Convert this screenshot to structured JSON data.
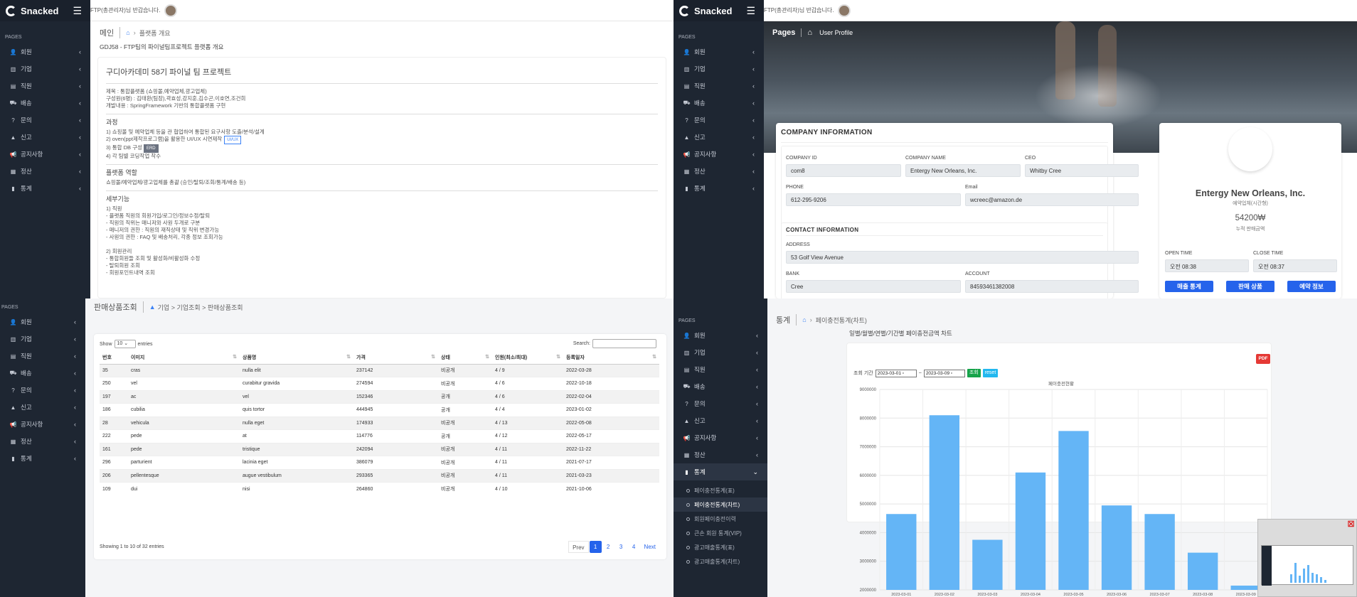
{
  "brand": "Snacked",
  "header": {
    "greeting": "FTP(총관리자)님 반갑습니다."
  },
  "sidebar": {
    "section": "PAGES",
    "items": [
      {
        "label": "회원",
        "icon": "user-icon"
      },
      {
        "label": "기업",
        "icon": "building-icon"
      },
      {
        "label": "직원",
        "icon": "id-card-icon"
      },
      {
        "label": "배송",
        "icon": "truck-icon"
      },
      {
        "label": "문의",
        "icon": "question-icon"
      },
      {
        "label": "신고",
        "icon": "warning-icon"
      },
      {
        "label": "공지사항",
        "icon": "megaphone-icon"
      },
      {
        "label": "정산",
        "icon": "receipt-icon"
      },
      {
        "label": "통계",
        "icon": "bar-chart-icon"
      }
    ],
    "stats_sub": [
      "페이충전통계(표)",
      "페이충전통계(차트)",
      "회원페이충전이력",
      "큰손 회원 통계(VIP)",
      "광고매출통계(표)",
      "광고매출통계(차트)"
    ]
  },
  "q1": {
    "crumb_title": "메인",
    "crumb_page": "플랫폼 개요",
    "heading": "GDJ58 - FTP팀의 파이널팀프로젝트 플랫폼 개요",
    "card_title": "구디아카데미 58기 파이널 팀 프로젝트",
    "info": [
      "제목 : 통합플랫폼 (쇼핑몰,예약업체,광고업체)",
      "구성원(6명) : 김태환(팀장),곽효성,강지훈,김수곤,이호연,조건희",
      "개발내용 : SpringFramework 기반의 통합플랫폼 구현"
    ],
    "process_title": "과정",
    "process": [
      "1) 쇼핑몰 및 예약업체 등을 관 협업하여 통합된 요구사항 도출/분석/설계",
      "2) oven(ppt제작프로그램)을 활용한 UI/UX 시연제작",
      "3) 통합 DB 구성",
      "4) 각 팀별 코딩작업 착수"
    ],
    "tag_uiux": "UI/UX",
    "tag_erd": "ERD",
    "role_title": "플랫폼 역할",
    "role": "쇼핑몰/예약업체/광고업체를 총괄 (승인/탈퇴/조회/통계/배송 등)",
    "detail_title": "세부기능",
    "detail": [
      "1) 직원",
      "- 플랫폼 직원의 회원가입/로그인/정보수정/탈퇴",
      "- 직원의 직위는 매니저와 사원 두개로 구분",
      "- 매니저의 권한 : 직원의 재직상태 및 직위 변경가능",
      "- 사원의 권한 : FAQ 및 배송처리, 각종 정보 조회가능",
      "",
      "2) 회원관리",
      "- 통합회원들 조회 및 활성화/비활성화 수정",
      "- 탈퇴회원 조회",
      "- 회원포인트내역 조회"
    ]
  },
  "q2": {
    "page_title": "Pages",
    "crumb_page": "User Profile",
    "company_title": "COMPANY INFORMATION",
    "company": [
      {
        "label": "COMPANY ID",
        "value": "com8"
      },
      {
        "label": "COMPANY NAME",
        "value": "Entergy New Orleans, Inc."
      },
      {
        "label": "CEO",
        "value": "Whitby Cree"
      },
      {
        "label": "PHONE",
        "value": "612-295-9206"
      },
      {
        "label": "Email",
        "value": "wcreec@amazon.de"
      }
    ],
    "contact_title": "CONTACT INFORMATION",
    "contact": [
      {
        "label": "ADDRESS",
        "value": "53 Golf View Avenue"
      },
      {
        "label": "BANK",
        "value": "Cree"
      },
      {
        "label": "ACCOUNT",
        "value": "84593461382008"
      }
    ],
    "profile": {
      "name": "Entergy New Orleans, Inc.",
      "type": "예약업체(시간형)",
      "amount": "54200₩",
      "amount_label": "누적 판매금액",
      "open_label": "OPEN TIME",
      "open": "오전 08:38",
      "close_label": "CLOSE TIME",
      "close": "오전 08:37",
      "buttons": [
        "매출 통계",
        "판매 상품",
        "예약 정보"
      ]
    }
  },
  "q3": {
    "crumb_title": "판매상품조회",
    "crumb_path": "기업 > 기업조회 > 판매상품조회",
    "show": "Show",
    "show_value": "10",
    "entries": "entries",
    "search_label": "Search:",
    "columns": [
      "번호",
      "이미지",
      "상품명",
      "가격",
      "상태",
      "인원(최소/최대)",
      "등록일자"
    ],
    "rows": [
      [
        "35",
        "cras",
        "nulla elit",
        "237142",
        "비공개",
        "4 / 9",
        "2022-03-28"
      ],
      [
        "250",
        "vel",
        "curabitur gravida",
        "274594",
        "비공개",
        "4 / 6",
        "2022-10-18"
      ],
      [
        "197",
        "ac",
        "vel",
        "152346",
        "공개",
        "4 / 6",
        "2022-02-04"
      ],
      [
        "186",
        "cubilia",
        "quis tortor",
        "444945",
        "공개",
        "4 / 4",
        "2023-01-02"
      ],
      [
        "28",
        "vehicula",
        "nulla eget",
        "174933",
        "비공개",
        "4 / 13",
        "2022-05-08"
      ],
      [
        "222",
        "pede",
        "at",
        "114776",
        "공개",
        "4 / 12",
        "2022-05-17"
      ],
      [
        "161",
        "pede",
        "tristique",
        "242094",
        "비공개",
        "4 / 11",
        "2022-11-22"
      ],
      [
        "296",
        "parturient",
        "lacinia eget",
        "386079",
        "비공개",
        "4 / 11",
        "2021-07-17"
      ],
      [
        "206",
        "pellentesque",
        "augue vestibulum",
        "293365",
        "비공개",
        "4 / 11",
        "2021-03-23"
      ],
      [
        "109",
        "dui",
        "nisi",
        "264860",
        "비공개",
        "4 / 10",
        "2021-10-06"
      ]
    ],
    "info": "Showing 1 to 10 of 32 entries",
    "pages": [
      "Prev",
      "1",
      "2",
      "3",
      "4",
      "Next"
    ]
  },
  "q4": {
    "crumb_title": "통계",
    "crumb_page": "페이충전통계(차트)",
    "subtitle": "일별/월별/연별/기간별 페이충전금액 차트",
    "pdf": "PDF",
    "period_label": "조회 기간",
    "from": "2023-03-01",
    "to": "2023-03-09",
    "tilde": "~",
    "btn_search": "조회",
    "btn_reset": "reset"
  },
  "chart_data": {
    "type": "bar",
    "title": "페이충전현황",
    "categories": [
      "2023-03-01",
      "2023-03-02",
      "2023-03-03",
      "2023-03-04",
      "2023-03-05",
      "2023-03-06",
      "2023-03-07",
      "2023-03-08",
      "2023-03-09"
    ],
    "values": [
      4650000,
      8100000,
      3750000,
      6100000,
      7550000,
      4950000,
      4650000,
      3300000,
      2150000
    ],
    "yticks": [
      "9000000",
      "8000000",
      "7000000",
      "6000000",
      "5000000",
      "4000000",
      "3000000",
      "2000000"
    ],
    "ylim": [
      2000000,
      9000000
    ],
    "grid": true,
    "bar_color": "#64b5f6"
  }
}
